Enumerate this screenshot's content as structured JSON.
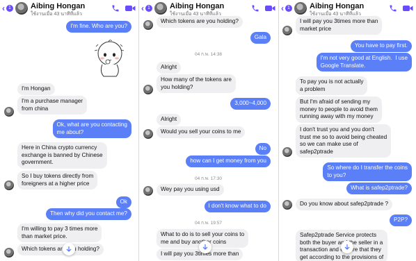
{
  "contact": {
    "name": "Aibing Hongan",
    "status": "ใช้งานเมื่อ 43 นาทีที่แล้ว",
    "unread_count": "1"
  },
  "colors": {
    "accent": "#6a4bff",
    "outgoing": "#5b7ff7",
    "incoming": "#efeff1"
  },
  "panels": [
    {
      "messages": [
        {
          "dir": "out",
          "text": "I'm fine. Who are you?"
        },
        {
          "dir": "sticker",
          "icon": "cartoon-baby-sticker"
        },
        {
          "dir": "in",
          "text": "I'm Hongan"
        },
        {
          "dir": "in",
          "text": "I'm a purchase manager\nfrom china"
        },
        {
          "dir": "out",
          "text": "Ok, what are you contacting\nme about?"
        },
        {
          "dir": "in",
          "text": "Here in China crypto currency\nexchange is banned by Chinese\ngovernment."
        },
        {
          "dir": "in",
          "text": "So I buy tokens directly from\nforeigners at a higher price"
        },
        {
          "dir": "out",
          "text": "Ok"
        },
        {
          "dir": "out",
          "text": "Then why did you contact me?"
        },
        {
          "dir": "in",
          "text": "I'm willing to pay 3 times more\nthan market price."
        },
        {
          "dir": "in",
          "text": "Which tokens are you holding?"
        }
      ]
    },
    {
      "messages": [
        {
          "dir": "in",
          "text": "Which tokens are you holding?"
        },
        {
          "dir": "out",
          "text": "Gala"
        },
        {
          "dir": "time",
          "text": "04 ก.พ. 14:38"
        },
        {
          "dir": "in",
          "text": "Alright"
        },
        {
          "dir": "in",
          "text": "How many of the tokens are\nyou holding?"
        },
        {
          "dir": "out",
          "text": "3,000~4,000"
        },
        {
          "dir": "in",
          "text": "Alright"
        },
        {
          "dir": "in",
          "text": "Would you sell your coins to me"
        },
        {
          "dir": "out",
          "text": "No"
        },
        {
          "dir": "out",
          "text": "how can I get money from you"
        },
        {
          "dir": "time",
          "text": "04 ก.พ. 17:30"
        },
        {
          "dir": "in",
          "text": "Wey pay you using usd"
        },
        {
          "dir": "out",
          "text": "I don't know what to do"
        },
        {
          "dir": "time",
          "text": "04 ก.พ. 19:57"
        },
        {
          "dir": "in",
          "text": "What to do is to sell your coins to\nme and buy another coins"
        },
        {
          "dir": "in",
          "text": "I will pay you 3times more than"
        }
      ]
    },
    {
      "messages": [
        {
          "dir": "in",
          "text": "I will pay you 3times more than\nmarket price"
        },
        {
          "dir": "out",
          "text": "You have to pay first."
        },
        {
          "dir": "out",
          "text": "I'm not very good at English.  I use\nGoogle Translate."
        },
        {
          "dir": "in",
          "text": "To pay you is not actually\na problem"
        },
        {
          "dir": "in",
          "text": "But I'm afraid of sending my\nmoney to people to avoid them\nrunning away with my money"
        },
        {
          "dir": "in",
          "text": "I don't trust you and you don't\ntrust me so to avoid being cheated\nso we can make use of\nsafep2ptrade"
        },
        {
          "dir": "out",
          "text": "So where do I transfer the coins\nto you?"
        },
        {
          "dir": "out",
          "text": "What is safep2ptrade?"
        },
        {
          "dir": "in",
          "text": "Do you know about safep2ptrade ?"
        },
        {
          "dir": "out",
          "text": "P2P?"
        },
        {
          "dir": "in",
          "text": "Safep2ptrade Service protects\nboth the buyer and the seller in a\ntransaction and ensure that they\nget according to the provisions of"
        }
      ]
    }
  ]
}
